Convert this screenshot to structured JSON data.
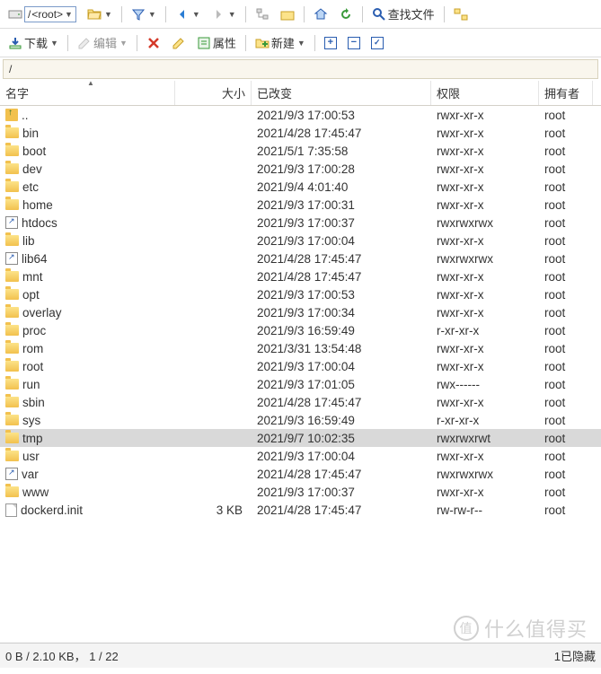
{
  "toolbar1": {
    "path_root": "/",
    "path_label": "<root>",
    "find_files": "查找文件"
  },
  "toolbar2": {
    "download": "下载",
    "edit": "编辑",
    "properties": "属性",
    "new": "新建"
  },
  "pathbar": "/",
  "columns": {
    "name": "名字",
    "size": "大小",
    "changed": "已改变",
    "rights": "权限",
    "owner": "拥有者"
  },
  "files": [
    {
      "icon": "up",
      "name": "..",
      "size": "",
      "changed": "2021/9/3 17:00:53",
      "rights": "rwxr-xr-x",
      "owner": "root",
      "sel": false
    },
    {
      "icon": "folder",
      "name": "bin",
      "size": "",
      "changed": "2021/4/28 17:45:47",
      "rights": "rwxr-xr-x",
      "owner": "root",
      "sel": false
    },
    {
      "icon": "folder",
      "name": "boot",
      "size": "",
      "changed": "2021/5/1 7:35:58",
      "rights": "rwxr-xr-x",
      "owner": "root",
      "sel": false
    },
    {
      "icon": "folder",
      "name": "dev",
      "size": "",
      "changed": "2021/9/3 17:00:28",
      "rights": "rwxr-xr-x",
      "owner": "root",
      "sel": false
    },
    {
      "icon": "folder",
      "name": "etc",
      "size": "",
      "changed": "2021/9/4 4:01:40",
      "rights": "rwxr-xr-x",
      "owner": "root",
      "sel": false
    },
    {
      "icon": "folder",
      "name": "home",
      "size": "",
      "changed": "2021/9/3 17:00:31",
      "rights": "rwxr-xr-x",
      "owner": "root",
      "sel": false
    },
    {
      "icon": "link",
      "name": "htdocs",
      "size": "",
      "changed": "2021/9/3 17:00:37",
      "rights": "rwxrwxrwx",
      "owner": "root",
      "sel": false
    },
    {
      "icon": "folder",
      "name": "lib",
      "size": "",
      "changed": "2021/9/3 17:00:04",
      "rights": "rwxr-xr-x",
      "owner": "root",
      "sel": false
    },
    {
      "icon": "link",
      "name": "lib64",
      "size": "",
      "changed": "2021/4/28 17:45:47",
      "rights": "rwxrwxrwx",
      "owner": "root",
      "sel": false
    },
    {
      "icon": "folder",
      "name": "mnt",
      "size": "",
      "changed": "2021/4/28 17:45:47",
      "rights": "rwxr-xr-x",
      "owner": "root",
      "sel": false
    },
    {
      "icon": "folder",
      "name": "opt",
      "size": "",
      "changed": "2021/9/3 17:00:53",
      "rights": "rwxr-xr-x",
      "owner": "root",
      "sel": false
    },
    {
      "icon": "folder",
      "name": "overlay",
      "size": "",
      "changed": "2021/9/3 17:00:34",
      "rights": "rwxr-xr-x",
      "owner": "root",
      "sel": false
    },
    {
      "icon": "folder",
      "name": "proc",
      "size": "",
      "changed": "2021/9/3 16:59:49",
      "rights": "r-xr-xr-x",
      "owner": "root",
      "sel": false
    },
    {
      "icon": "folder",
      "name": "rom",
      "size": "",
      "changed": "2021/3/31 13:54:48",
      "rights": "rwxr-xr-x",
      "owner": "root",
      "sel": false
    },
    {
      "icon": "folder",
      "name": "root",
      "size": "",
      "changed": "2021/9/3 17:00:04",
      "rights": "rwxr-xr-x",
      "owner": "root",
      "sel": false
    },
    {
      "icon": "folder",
      "name": "run",
      "size": "",
      "changed": "2021/9/3 17:01:05",
      "rights": "rwx------",
      "owner": "root",
      "sel": false
    },
    {
      "icon": "folder",
      "name": "sbin",
      "size": "",
      "changed": "2021/4/28 17:45:47",
      "rights": "rwxr-xr-x",
      "owner": "root",
      "sel": false
    },
    {
      "icon": "folder",
      "name": "sys",
      "size": "",
      "changed": "2021/9/3 16:59:49",
      "rights": "r-xr-xr-x",
      "owner": "root",
      "sel": false
    },
    {
      "icon": "folder",
      "name": "tmp",
      "size": "",
      "changed": "2021/9/7 10:02:35",
      "rights": "rwxrwxrwt",
      "owner": "root",
      "sel": true
    },
    {
      "icon": "folder",
      "name": "usr",
      "size": "",
      "changed": "2021/9/3 17:00:04",
      "rights": "rwxr-xr-x",
      "owner": "root",
      "sel": false
    },
    {
      "icon": "link",
      "name": "var",
      "size": "",
      "changed": "2021/4/28 17:45:47",
      "rights": "rwxrwxrwx",
      "owner": "root",
      "sel": false
    },
    {
      "icon": "folder",
      "name": "www",
      "size": "",
      "changed": "2021/9/3 17:00:37",
      "rights": "rwxr-xr-x",
      "owner": "root",
      "sel": false
    },
    {
      "icon": "file",
      "name": "dockerd.init",
      "size": "3 KB",
      "changed": "2021/4/28 17:45:47",
      "rights": "rw-rw-r--",
      "owner": "root",
      "sel": false
    }
  ],
  "status": {
    "left": "0 B / 2.10 KB， 1 / 22",
    "right": "1已隐藏"
  },
  "watermark": "什么值得买"
}
